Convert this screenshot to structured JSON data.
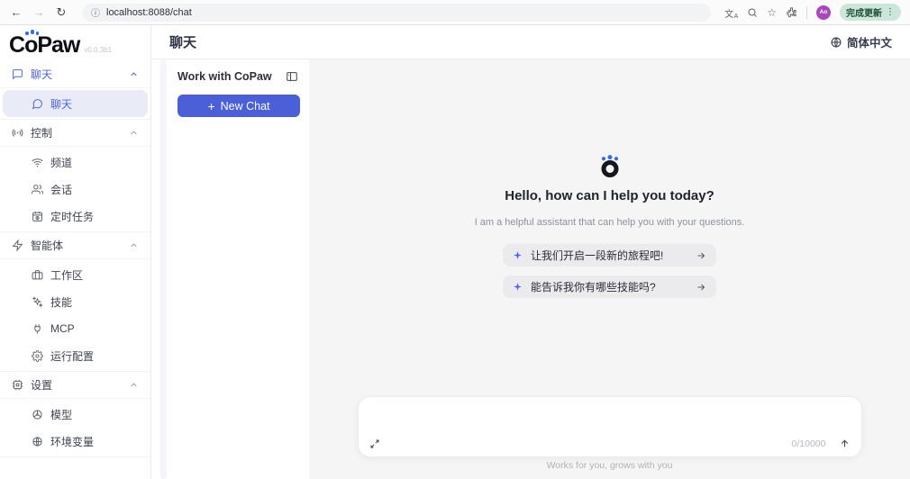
{
  "browser": {
    "back_icon": "←",
    "forward_icon": "→",
    "reload_icon": "↻",
    "info_icon": "ⓘ",
    "url": "localhost:8088/chat",
    "translate_icon_main": "文",
    "translate_icon_sub": "A",
    "bookmark_icon": "☆",
    "avatar": "Ao",
    "update_label": "完成更新",
    "menu_icon": "⋮"
  },
  "sidebar": {
    "logo": {
      "c": "C",
      "o": "o",
      "paw": "Paw",
      "version": "v0.0.3b1"
    },
    "groups": [
      {
        "label": "聊天",
        "icon": "chat-square-icon",
        "active": true,
        "items": [
          {
            "label": "聊天",
            "icon": "chat-bubble-icon",
            "active": true
          }
        ]
      },
      {
        "label": "控制",
        "icon": "radio-icon",
        "items": [
          {
            "label": "频道",
            "icon": "wifi-icon"
          },
          {
            "label": "会话",
            "icon": "users-icon"
          },
          {
            "label": "定时任务",
            "icon": "calendar-clock-icon"
          }
        ]
      },
      {
        "label": "智能体",
        "icon": "zap-icon",
        "items": [
          {
            "label": "工作区",
            "icon": "briefcase-icon"
          },
          {
            "label": "技能",
            "icon": "sparkles-icon"
          },
          {
            "label": "MCP",
            "icon": "plug-icon"
          },
          {
            "label": "运行配置",
            "icon": "gear-icon"
          }
        ]
      },
      {
        "label": "设置",
        "icon": "cpu-icon",
        "items": [
          {
            "label": "模型",
            "icon": "helm-icon"
          },
          {
            "label": "环境变量",
            "icon": "globe-icon"
          }
        ]
      }
    ]
  },
  "header": {
    "title": "聊天",
    "language": "简体中文",
    "language_icon": "globe-icon"
  },
  "work_panel": {
    "title": "Work with CoPaw",
    "toggle_icon": "panel-toggle-icon",
    "new_chat_plus": "+",
    "new_chat_label": "New Chat"
  },
  "main": {
    "greeting": "Hello, how can I help you today?",
    "subtitle": "I am a helpful assistant that can help you with your questions.",
    "suggestions": [
      {
        "icon": "sparkle-icon",
        "label": "让我们开启一段新的旅程吧!"
      },
      {
        "icon": "sparkle-icon",
        "label": "能告诉我你有哪些技能吗?"
      }
    ],
    "composer": {
      "value": "",
      "counter": "0/10000"
    },
    "footer": "Works for you, grows with you"
  },
  "colors": {
    "accent": "#4a5fd8",
    "accent_text": "#4b63e2",
    "active_item_bg": "#e9ecf7",
    "main_bg": "#f5f5f6",
    "paw_blue": "#2f6bf6"
  }
}
